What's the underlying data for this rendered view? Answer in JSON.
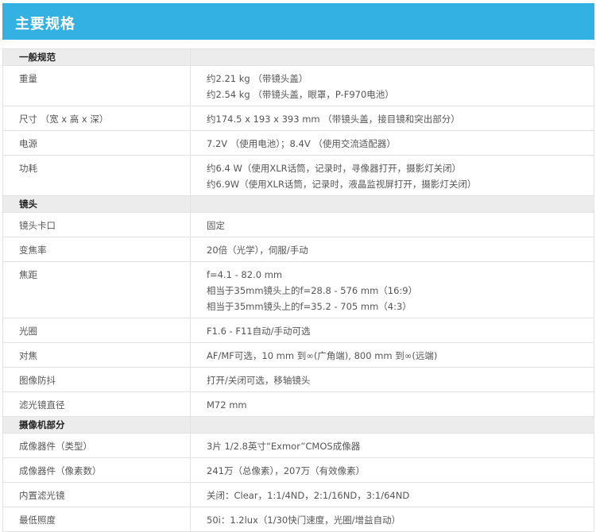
{
  "header": {
    "title": "主要规格"
  },
  "sections": [
    {
      "title": "一般规范",
      "rows": [
        {
          "label": "重量",
          "lines": [
            "约2.21 kg （带镜头盖）",
            "约2.54 kg （带镜头盖，眼罩，P-F970电池）"
          ]
        },
        {
          "label": "尺寸 （宽 x 高 x 深）",
          "lines": [
            "约174.5 x 193 x 393 mm （带镜头盖，接目镜和突出部分）"
          ]
        },
        {
          "label": "电源",
          "lines": [
            "7.2V （使用电池）；8.4V （使用交流适配器）"
          ]
        },
        {
          "label": "功耗",
          "lines": [
            "约6.4 W（使用XLR话筒，记录时，寻像器打开，摄影灯关闭）",
            "约6.9W（使用XLR话筒，记录时，液晶监视屏打开，摄影灯关闭）"
          ]
        }
      ]
    },
    {
      "title": "镜头",
      "rows": [
        {
          "label": "镜头卡口",
          "lines": [
            "固定"
          ]
        },
        {
          "label": "变焦率",
          "lines": [
            "20倍（光学），伺服/手动"
          ]
        },
        {
          "label": "焦距",
          "lines": [
            "f=4.1 - 82.0 mm",
            "相当于35mm镜头上的f=28.8 - 576 mm（16:9）",
            "相当于35mm镜头上的f=35.2 - 705 mm（4:3）"
          ]
        },
        {
          "label": "光圈",
          "lines": [
            "F1.6 - F11自动/手动可选"
          ]
        },
        {
          "label": "对焦",
          "lines": [
            "AF/MF可选，10 mm 到∞(广角端), 800 mm 到∞(远端)"
          ]
        },
        {
          "label": "图像防抖",
          "lines": [
            "打开/关闭可选，移轴镜头"
          ]
        },
        {
          "label": "滤光镜直径",
          "lines": [
            "M72 mm"
          ]
        }
      ]
    },
    {
      "title": "摄像机部分",
      "rows": [
        {
          "label": "成像器件（类型）",
          "lines": [
            "3片 1/2.8英寸“Exmor”CMOS成像器"
          ]
        },
        {
          "label": "成像器件（像素数）",
          "lines": [
            "241万（总像素），207万（有效像素）"
          ]
        },
        {
          "label": "内置滤光镜",
          "lines": [
            "关闭：Clear，1:1/4ND，2:1/16ND，3:1/64ND"
          ]
        },
        {
          "label": "最低照度",
          "lines": [
            "50i：1.2lux（1/30快门速度，光圈/增益自动）"
          ]
        }
      ]
    }
  ]
}
